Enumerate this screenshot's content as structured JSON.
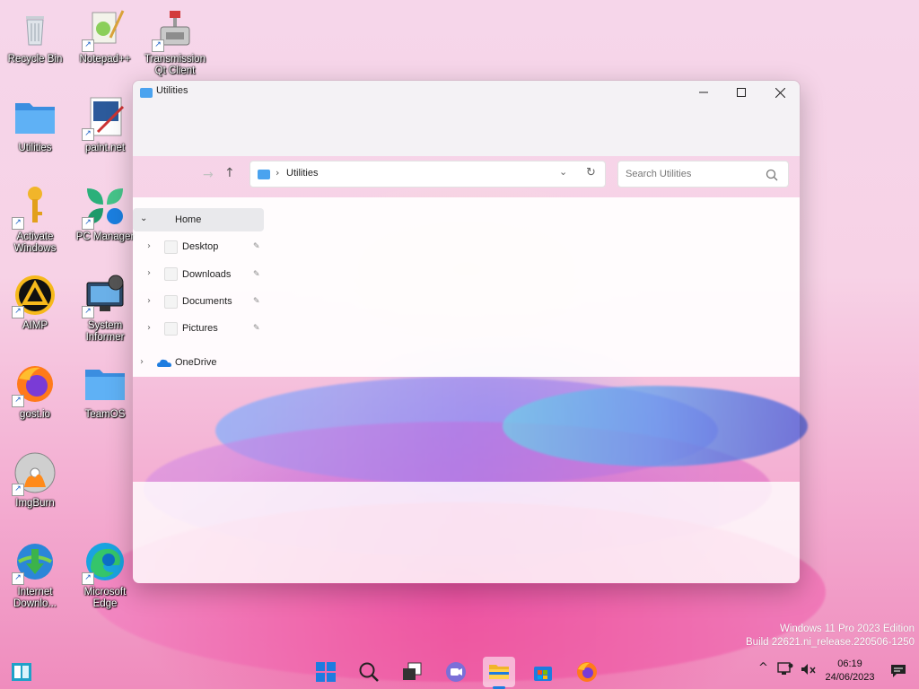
{
  "desktop": {
    "icons": [
      {
        "label": "Recycle Bin",
        "icon": "recycle-bin-icon"
      },
      {
        "label": "Notepad++",
        "icon": "notepad-plus-plus-icon"
      },
      {
        "label": "Transmission Qt Client",
        "icon": "transmission-icon"
      },
      {
        "label": "Utilities",
        "icon": "folder-icon"
      },
      {
        "label": "paint.net",
        "icon": "paint-net-icon"
      },
      {
        "label": "Activate Windows",
        "icon": "key-icon"
      },
      {
        "label": "PC Manager",
        "icon": "pc-manager-icon"
      },
      {
        "label": "AIMP",
        "icon": "aimp-icon"
      },
      {
        "label": "System Informer",
        "icon": "system-informer-icon"
      },
      {
        "label": "gost.io",
        "icon": "firefox-icon"
      },
      {
        "label": "TeamOS",
        "icon": "folder-icon"
      },
      {
        "label": "ImgBurn",
        "icon": "imgburn-icon"
      },
      {
        "label": "Internet Downlo...",
        "icon": "internet-download-manager-icon"
      },
      {
        "label": "Microsoft Edge",
        "icon": "edge-icon"
      }
    ]
  },
  "window": {
    "title": "Utilities",
    "address": {
      "breadcrumb_sep": "›",
      "current": "Utilities"
    },
    "search": {
      "placeholder": "Search Utilities"
    },
    "nav": {
      "home": "Home",
      "quick_access": [
        "Desktop",
        "Downloads",
        "Documents",
        "Pictures"
      ],
      "onedrive": "OneDrive"
    }
  },
  "watermark": {
    "line1": "Windows 11 Pro 2023 Edition",
    "line2": "Build 22621.ni_release.220506-1250"
  },
  "clock": {
    "time": "06:19",
    "date": "24/06/2023"
  },
  "colors": {
    "accent": "#1e7ce0",
    "folder": "#4aa3ef"
  }
}
